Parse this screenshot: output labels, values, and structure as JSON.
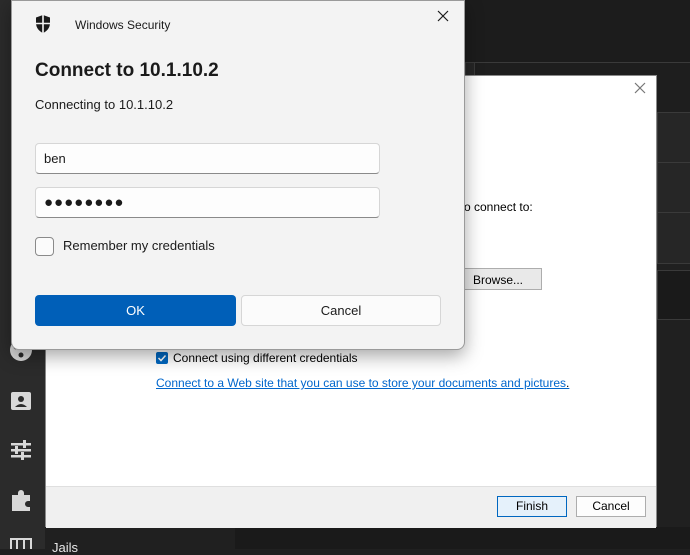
{
  "background_app": {
    "sidebar_label": "Jails",
    "icons": [
      "puzzle-icon",
      "sliders-icon",
      "contact-icon",
      "network-icon"
    ]
  },
  "wizard": {
    "connect_to_text": "o connect to:",
    "browse_label": "Browse...",
    "different_credentials_label": "Connect using different credentials",
    "different_credentials_checked": true,
    "web_link_text": "Connect to a Web site that you can use to store your documents and pictures",
    "web_link_suffix": ".",
    "finish_label": "Finish",
    "cancel_label": "Cancel"
  },
  "security_dialog": {
    "app_title": "Windows Security",
    "heading": "Connect to 10.1.10.2",
    "subtext": "Connecting to 10.1.10.2",
    "username_value": "ben",
    "password_value": "●●●●●●●●",
    "remember_label": "Remember my credentials",
    "remember_checked": false,
    "ok_label": "OK",
    "cancel_label": "Cancel"
  },
  "colors": {
    "accent": "#005fb8",
    "link": "#0066cc",
    "dark_background": "#202020"
  }
}
